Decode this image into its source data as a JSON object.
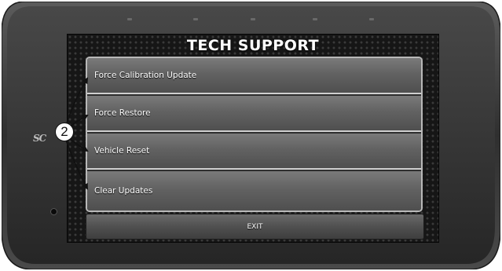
{
  "device": {
    "brand_logo": "SC",
    "bezel_color": "#3a3a3a",
    "screen_bg": "#161616"
  },
  "screen": {
    "title": "TECH SUPPORT",
    "menu_items": [
      {
        "label": "Force Calibration Update"
      },
      {
        "label": "Force Restore"
      },
      {
        "label": "Vehicle Reset"
      },
      {
        "label": "Clear Updates"
      }
    ],
    "exit_label": "EXIT"
  },
  "callout": {
    "number": "2"
  }
}
